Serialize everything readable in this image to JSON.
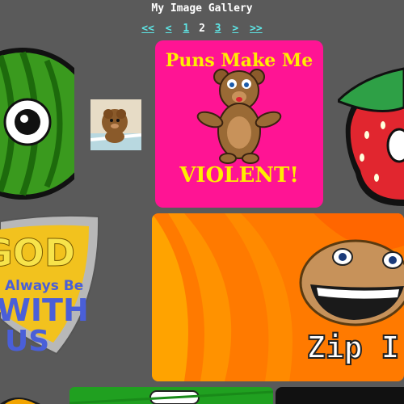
{
  "page": {
    "title": "My Image Gallery"
  },
  "pager": {
    "first": "<<",
    "prev": "<",
    "pages": [
      "1",
      "2",
      "3"
    ],
    "current": "2",
    "next": ">",
    "last": ">>"
  },
  "thumbs": {
    "puns": {
      "line1": "Puns Make Me",
      "line2": "VIOLENT!"
    },
    "shield": {
      "line1": "GOD",
      "line2": "Always Be",
      "line3": "WITH",
      "line4": "US"
    },
    "zip": {
      "caption": "Zip I"
    }
  },
  "colors": {
    "background": "#5a5a5a",
    "link": "#5ee6e6",
    "puns_bg": "#ff1494",
    "puns_text": "#ffee00",
    "zip_orange": "#ff7a00"
  }
}
